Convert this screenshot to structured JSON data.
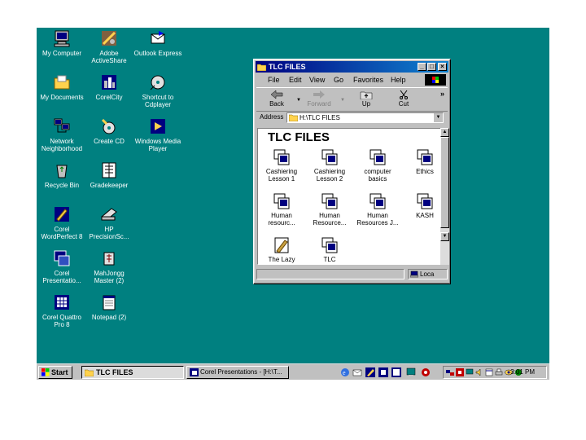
{
  "desktop": {
    "icons": [
      {
        "label": "My Computer",
        "icon": "my-computer-icon"
      },
      {
        "label": "Adobe ActiveShare",
        "icon": "adobe-activeshare-icon"
      },
      {
        "label": "Outlook Express",
        "icon": "outlook-express-icon"
      },
      {
        "label": "My Documents",
        "icon": "my-documents-icon"
      },
      {
        "label": "CorelCity",
        "icon": "corelcity-icon"
      },
      {
        "label": "Shortcut to Cdplayer",
        "icon": "cdplayer-icon"
      },
      {
        "label": "Network Neighborhood",
        "icon": "network-icon"
      },
      {
        "label": "Create CD",
        "icon": "create-cd-icon"
      },
      {
        "label": "Windows Media Player",
        "icon": "media-player-icon"
      },
      {
        "label": "Recycle Bin",
        "icon": "recycle-bin-icon"
      },
      {
        "label": "Gradekeeper",
        "icon": "gradekeeper-icon"
      },
      {
        "label": "Corel WordPerfect 8",
        "icon": "wordperfect-icon"
      },
      {
        "label": "HP PrecisionSc...",
        "icon": "scanner-icon"
      },
      {
        "label": "Corel Presentatio...",
        "icon": "corel-presentations-icon"
      },
      {
        "label": "MahJongg Master (2)",
        "icon": "mahjongg-icon"
      },
      {
        "label": "Corel Quattro Pro 8",
        "icon": "quattro-pro-icon"
      },
      {
        "label": "Notepad (2)",
        "icon": "notepad-icon"
      }
    ]
  },
  "window": {
    "title": "TLC FILES",
    "menu": [
      "File",
      "Edit",
      "View",
      "Go",
      "Favorites",
      "Help"
    ],
    "toolbar": {
      "back": "Back",
      "forward": "Forward",
      "up": "Up",
      "cut": "Cut",
      "more": "»"
    },
    "address_label": "Address",
    "address_value": "H:\\TLC FILES",
    "content_heading": "TLC FILES",
    "files": [
      {
        "label": "Cashiering Lesson 1"
      },
      {
        "label": "Cashiering Lesson 2"
      },
      {
        "label": "computer basics"
      },
      {
        "label": "Ethics"
      },
      {
        "label": "Human resourc..."
      },
      {
        "label": "Human Resource..."
      },
      {
        "label": "Human Resources J..."
      },
      {
        "label": "KASH"
      },
      {
        "label": "The Lazy"
      },
      {
        "label": "TLC"
      }
    ],
    "status": "Loca"
  },
  "taskbar": {
    "start": "Start",
    "items": [
      "TLC FILES",
      "Corel Presentations - [H:\\T..."
    ],
    "clock": "3:01 PM"
  },
  "colors": {
    "desktop": "#008080",
    "titlebar": "#000080",
    "face": "#c0c0c0"
  }
}
